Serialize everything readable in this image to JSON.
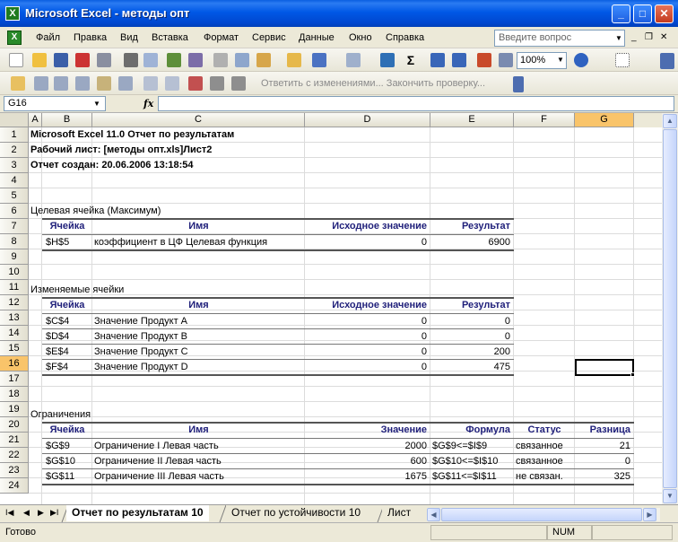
{
  "window": {
    "title": "Microsoft Excel - методы опт",
    "app_icon": "X",
    "minimize": "_",
    "maximize": "□",
    "close": "✕"
  },
  "menu": {
    "items": [
      "Файл",
      "Правка",
      "Вид",
      "Вставка",
      "Формат",
      "Сервис",
      "Данные",
      "Окно",
      "Справка"
    ],
    "help_placeholder": "Введите вопрос"
  },
  "toolbar": {
    "zoom": "100%",
    "review_text": "Ответить с изменениями...  Закончить проверку..."
  },
  "formula_bar": {
    "name_box": "G16",
    "fx": "fx",
    "formula": ""
  },
  "columns": [
    "A",
    "B",
    "C",
    "D",
    "E",
    "F",
    "G"
  ],
  "rows": [
    "1",
    "2",
    "3",
    "4",
    "5",
    "6",
    "7",
    "8",
    "9",
    "10",
    "11",
    "12",
    "13",
    "14",
    "15",
    "16",
    "17",
    "18",
    "19",
    "20",
    "21",
    "22",
    "23",
    "24"
  ],
  "selected_cell": "G16",
  "report": {
    "title": "Microsoft Excel 11.0 Отчет по результатам",
    "worksheet": "Рабочий лист: [методы опт.xls]Лист2",
    "created": "Отчет создан: 20.06.2006 13:18:54",
    "target_section": {
      "title": "Целевая ячейка (Максимум)",
      "headers": [
        "Ячейка",
        "Имя",
        "Исходное значение",
        "Результат"
      ],
      "rows": [
        [
          "$H$5",
          "коэффициент в ЦФ Целевая функция",
          "0",
          "6900"
        ]
      ]
    },
    "changing_section": {
      "title": "Изменяемые ячейки",
      "headers": [
        "Ячейка",
        "Имя",
        "Исходное значение",
        "Результат"
      ],
      "rows": [
        [
          "$C$4",
          "Значение Продукт A",
          "0",
          "0"
        ],
        [
          "$D$4",
          "Значение Продукт B",
          "0",
          "0"
        ],
        [
          "$E$4",
          "Значение Продукт C",
          "0",
          "200"
        ],
        [
          "$F$4",
          "Значение Продукт D",
          "0",
          "475"
        ]
      ]
    },
    "constraints_section": {
      "title": "Ограничения",
      "headers": [
        "Ячейка",
        "Имя",
        "Значение",
        "Формула",
        "Статус",
        "Разница"
      ],
      "rows": [
        [
          "$G$9",
          "Ограничение I Левая часть",
          "2000",
          "$G$9<=$I$9",
          "связанное",
          "21"
        ],
        [
          "$G$10",
          "Ограничение II Левая часть",
          "600",
          "$G$10<=$I$10",
          "связанное",
          "0"
        ],
        [
          "$G$11",
          "Ограничение III Левая часть",
          "1675",
          "$G$11<=$I$11",
          "не связан.",
          "325"
        ]
      ]
    }
  },
  "sheet_tabs": [
    {
      "label": "Отчет по результатам 10",
      "active": true
    },
    {
      "label": "Отчет по устойчивости 10",
      "active": false
    },
    {
      "label": "Лист",
      "active": false
    }
  ],
  "status": {
    "text": "Готово",
    "num": "NUM"
  }
}
